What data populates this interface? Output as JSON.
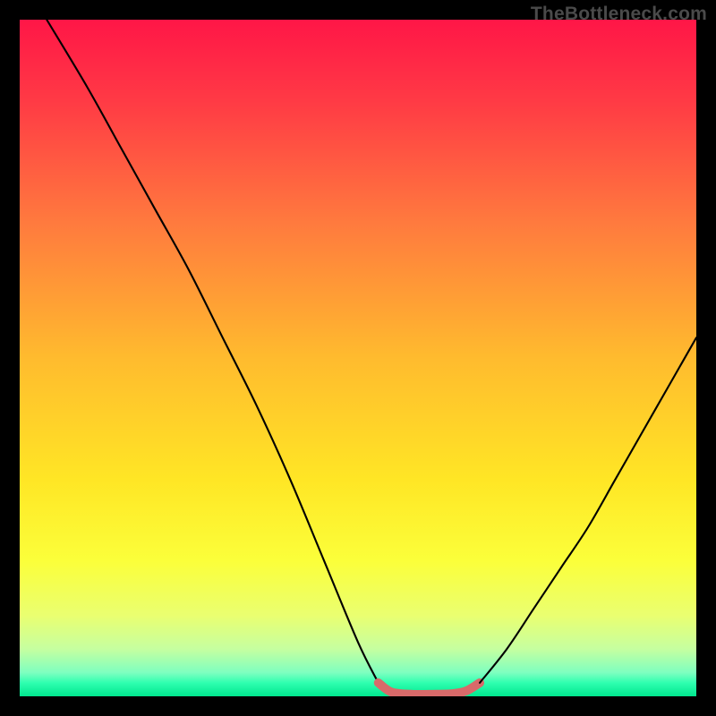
{
  "watermark": {
    "text": "TheBottleneck.com"
  },
  "chart_data": {
    "type": "line",
    "title": "",
    "xlabel": "",
    "ylabel": "",
    "xlim": [
      0,
      100
    ],
    "ylim": [
      0,
      100
    ],
    "grid": false,
    "legend": false,
    "series": [
      {
        "name": "left-curve",
        "stroke": "#000000",
        "x": [
          4,
          10,
          15,
          20,
          25,
          30,
          35,
          40,
          45,
          50,
          53
        ],
        "y": [
          100,
          90,
          81,
          72,
          63,
          53,
          43,
          32,
          20,
          8,
          2
        ]
      },
      {
        "name": "plateau-highlight",
        "stroke": "#d86a6a",
        "x": [
          53,
          55,
          58,
          61,
          64,
          66,
          68
        ],
        "y": [
          2,
          0.6,
          0.3,
          0.3,
          0.4,
          0.8,
          2
        ]
      },
      {
        "name": "right-curve",
        "stroke": "#000000",
        "x": [
          68,
          72,
          76,
          80,
          84,
          88,
          92,
          96,
          100
        ],
        "y": [
          2,
          7,
          13,
          19,
          25,
          32,
          39,
          46,
          53
        ]
      }
    ],
    "background_gradient": {
      "stops": [
        {
          "offset": 0.0,
          "color": "#ff1647"
        },
        {
          "offset": 0.12,
          "color": "#ff3a45"
        },
        {
          "offset": 0.3,
          "color": "#ff7a3e"
        },
        {
          "offset": 0.5,
          "color": "#ffbb2e"
        },
        {
          "offset": 0.68,
          "color": "#ffe625"
        },
        {
          "offset": 0.8,
          "color": "#fbff3a"
        },
        {
          "offset": 0.88,
          "color": "#eaff70"
        },
        {
          "offset": 0.93,
          "color": "#c6ffa0"
        },
        {
          "offset": 0.965,
          "color": "#7effc0"
        },
        {
          "offset": 0.98,
          "color": "#2fffb0"
        },
        {
          "offset": 1.0,
          "color": "#00e78e"
        }
      ]
    }
  }
}
